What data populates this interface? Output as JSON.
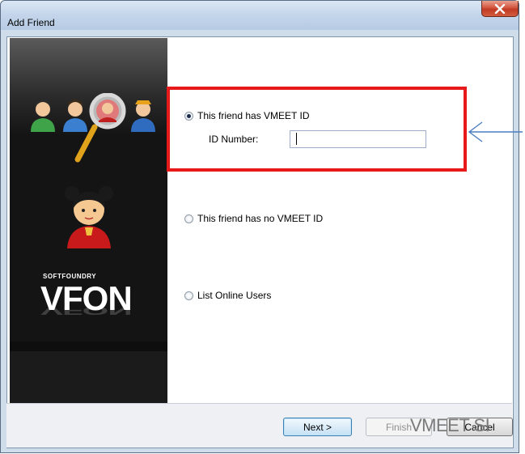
{
  "window": {
    "title": "Add Friend",
    "close_symbol": "x"
  },
  "sidebar": {
    "brand_small": "SOFTFOUNDRY",
    "brand_large": "VFON",
    "icons": [
      "user-green-icon",
      "user-blue-icon",
      "search-magnifier-icon",
      "user-orange-icon",
      "girl-avatar-icon"
    ]
  },
  "options": {
    "has_id_label": "This friend has VMEET ID",
    "has_id_selected": true,
    "id_number_label": "ID Number:",
    "id_number_value": "",
    "no_id_label": "This friend has no VMEET ID",
    "online_label": "List Online Users"
  },
  "buttons": {
    "next": "Next >",
    "finish": "Finish",
    "cancel": "Cancel"
  },
  "overlay_text": "VMEET SI",
  "colors": {
    "highlight_box": "#e8191b",
    "arrow": "#4a7fc0"
  }
}
